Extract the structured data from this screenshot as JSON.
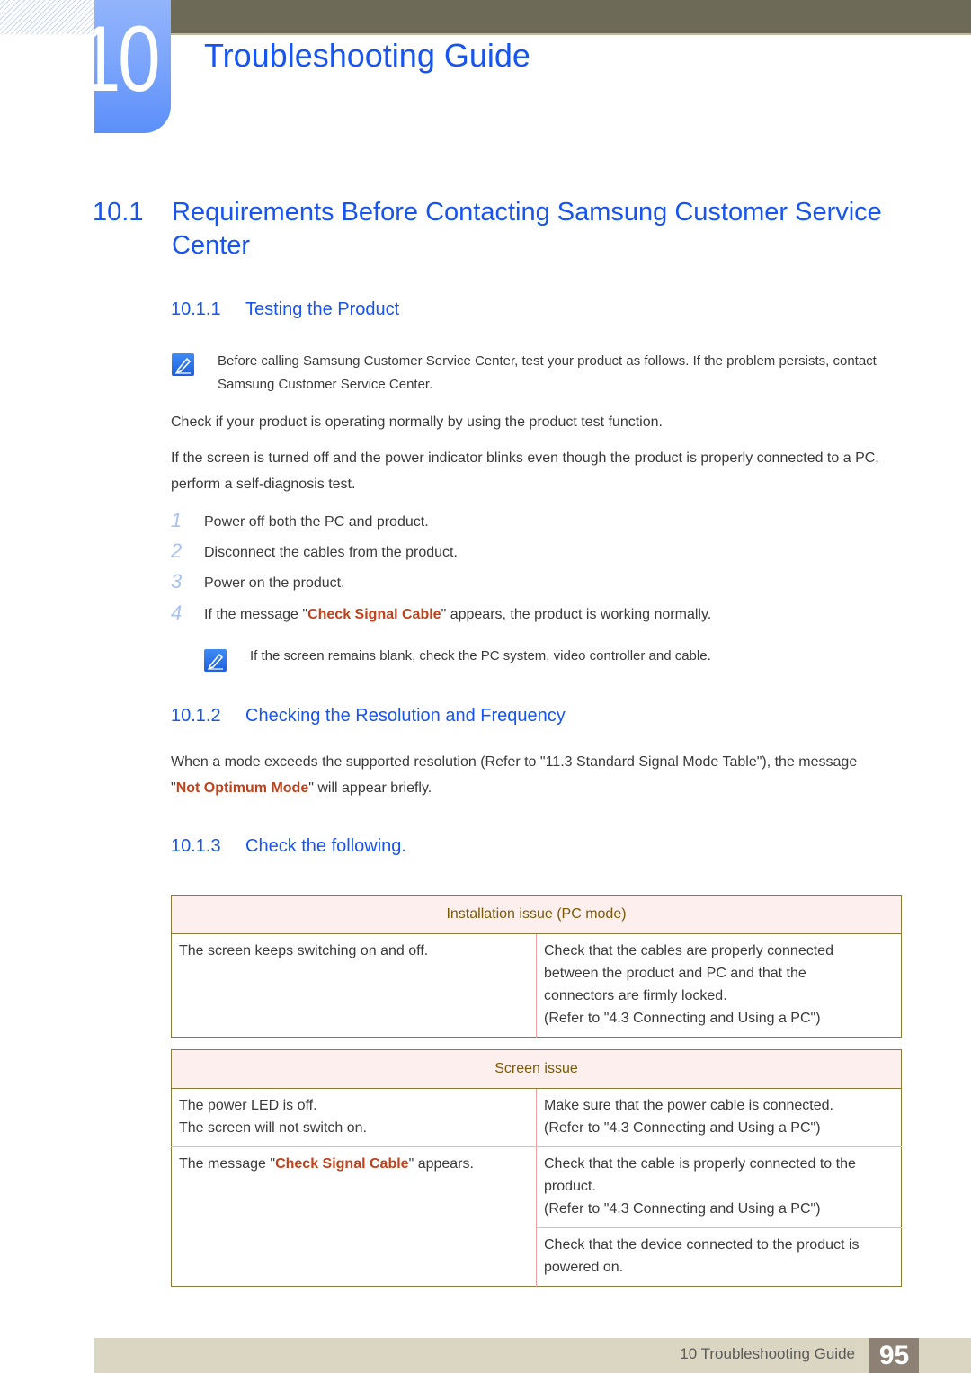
{
  "chapter": {
    "number": "10",
    "title": "Troubleshooting Guide"
  },
  "section": {
    "number": "10.1",
    "title": "Requirements Before Contacting Samsung Customer Service Center"
  },
  "sub1": {
    "number": "10.1.1",
    "title": "Testing the Product",
    "note": "Before calling Samsung Customer Service Center, test your product as follows. If the problem persists, contact Samsung Customer Service Center.",
    "para1": "Check if your product is operating normally by using the product test function.",
    "para2": "If the screen is turned off and the power indicator blinks even though the product is properly connected to a PC, perform a self-diagnosis test.",
    "steps": [
      {
        "n": "1",
        "text": "Power off both the PC and product."
      },
      {
        "n": "2",
        "text": "Disconnect the cables from the product."
      },
      {
        "n": "3",
        "text": "Power on the product."
      },
      {
        "n": "4",
        "pre": "If the message \"",
        "highlight": "Check Signal Cable",
        "post": "\" appears, the product is working normally."
      }
    ],
    "step_note": "If the screen remains blank, check the PC system, video controller and cable."
  },
  "sub2": {
    "number": "10.1.2",
    "title": "Checking the Resolution and Frequency",
    "pre": "When a mode exceeds the supported resolution (Refer to \"11.3 Standard Signal Mode Table\"), the message \"",
    "highlight": "Not Optimum Mode",
    "post": "\" will appear briefly."
  },
  "sub3": {
    "number": "10.1.3",
    "title": "Check the following."
  },
  "table1": {
    "header": "Installation issue (PC mode)",
    "rows": [
      {
        "problem": "The screen keeps switching on and off.",
        "solution_lines": [
          "Check that the cables are properly connected",
          "between the product and PC and that the",
          "connectors are firmly locked.",
          "(Refer to \"4.3 Connecting and Using a PC\")"
        ]
      }
    ]
  },
  "table2": {
    "header": "Screen issue",
    "rows": [
      {
        "problem_lines": [
          "The power LED is off.",
          "The screen will not switch on."
        ],
        "solution_lines": [
          "Make sure that the power cable is connected.",
          "(Refer to \"4.3 Connecting and Using a PC\")"
        ]
      },
      {
        "problem_pre": "The message \"",
        "problem_highlight": "Check Signal Cable",
        "problem_post": "\" appears.",
        "solution_lines": [
          "Check that the cable is properly connected to the",
          "product.",
          "(Refer to \"4.3 Connecting and Using a PC\")"
        ]
      },
      {
        "solution_lines": [
          "Check that the device connected to the product is",
          "powered on."
        ]
      }
    ]
  },
  "footer": {
    "label": "10 Troubleshooting Guide",
    "page": "95"
  },
  "colors": {
    "heading_blue": "#1754f0",
    "highlight_red": "#c0421c",
    "table_header_text": "#7a5a08",
    "table_header_bg": "#fcefed",
    "top_bar": "#6d6b57",
    "footer_bg": "#dbd6c1",
    "page_box": "#8d8176"
  }
}
